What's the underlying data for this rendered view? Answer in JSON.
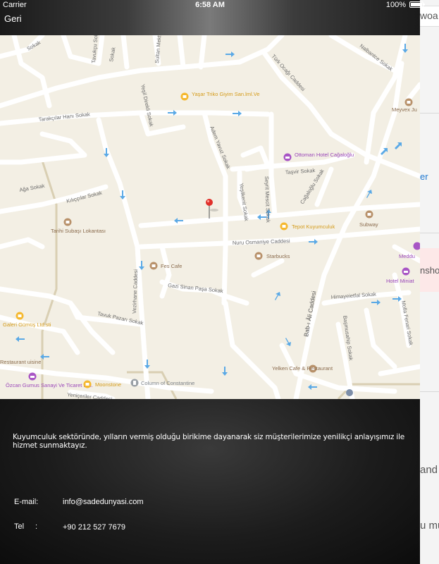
{
  "status_bar": {
    "carrier": "Carrier",
    "time": "6:58 AM",
    "battery": "100%"
  },
  "nav": {
    "back_label": "Geri"
  },
  "map": {
    "streets": [
      {
        "id": "s1",
        "label": "Sokak"
      },
      {
        "id": "s2",
        "label": "Tavukçu Sokak"
      },
      {
        "id": "s3",
        "label": "Sokak"
      },
      {
        "id": "s4",
        "label": "Sultan Mektebi Sokak"
      },
      {
        "id": "s5",
        "label": "Yeşil Direkli Sokak"
      },
      {
        "id": "s6",
        "label": "Türk Ocağı Caddesi"
      },
      {
        "id": "s7",
        "label": "Nalbantce Sokak"
      },
      {
        "id": "s8",
        "label": "Tarakçılar Hanı Sokak"
      },
      {
        "id": "s9",
        "label": "Adem Yavuz Sokak"
      },
      {
        "id": "s10",
        "label": "Taşvir Sokak"
      },
      {
        "id": "s11",
        "label": "Ağa Sokak"
      },
      {
        "id": "s12",
        "label": "Kılıççılar Sokak"
      },
      {
        "id": "s13",
        "label": "Yeşilkenit Sokak"
      },
      {
        "id": "s14",
        "label": "Seyrit Mescit Sokak"
      },
      {
        "id": "s15",
        "label": "Cağaloğlu Sokak"
      },
      {
        "id": "s16",
        "label": "Nuru Osmaniye Caddesi"
      },
      {
        "id": "s17",
        "label": "Vezirhane Caddesi"
      },
      {
        "id": "s18",
        "label": "Gazi Sinan Paşa Sokak"
      },
      {
        "id": "s19",
        "label": "Tavuk Pazarı Sokak"
      },
      {
        "id": "s20",
        "label": "Bab-ı Âli Caddesi"
      },
      {
        "id": "s21",
        "label": "Himayeietfal Sokak"
      },
      {
        "id": "s22",
        "label": "Başmusahip Sokak"
      },
      {
        "id": "s23",
        "label": "Molla Fenari Sokak"
      },
      {
        "id": "s24",
        "label": "Yeniçeriler Caddesi"
      }
    ],
    "pois": [
      {
        "id": "p1",
        "name": "Yaşar Triko Giyim San.lml.Ve",
        "icon": "shopping-bag-icon",
        "color": "#f5b82e"
      },
      {
        "id": "p2",
        "name": "Meyvex Ju",
        "icon": "cafe-icon",
        "color": "#b8916a"
      },
      {
        "id": "p3",
        "name": "Ottoman Hotel Cağaloğlu",
        "icon": "hotel-icon",
        "color": "#a855c5"
      },
      {
        "id": "p4",
        "name": "Subway",
        "icon": "food-icon",
        "color": "#b8916a"
      },
      {
        "id": "p5",
        "name": "Tepot Kuyumculuk",
        "icon": "shopping-bag-icon",
        "color": "#f5b82e"
      },
      {
        "id": "p6",
        "name": "Tarihi Subaşı Lokantası",
        "icon": "food-icon",
        "color": "#b8916a"
      },
      {
        "id": "p7",
        "name": "Starbucks",
        "icon": "cafe-icon",
        "color": "#b8916a"
      },
      {
        "id": "p8",
        "name": "Fes Cafe",
        "icon": "cafe-icon",
        "color": "#b8916a"
      },
      {
        "id": "p9",
        "name": "Meddu",
        "icon": "hotel-icon",
        "color": "#a855c5"
      },
      {
        "id": "p10",
        "name": "Hotel Miniat",
        "icon": "hotel-icon",
        "color": "#a855c5"
      },
      {
        "id": "p11",
        "name": "Galeri Gümüş Ltd.sti",
        "icon": "shopping-bag-icon",
        "color": "#f5b82e"
      },
      {
        "id": "p12",
        "name": "Restaurant uisine",
        "icon": "food-icon",
        "color": "#b8916a"
      },
      {
        "id": "p13",
        "name": "Özcan Gumus Sanayi Ve Ticaret L.S.",
        "icon": "hotel-icon",
        "color": "#a855c5"
      },
      {
        "id": "p14",
        "name": "Moonstone",
        "icon": "shopping-bag-icon",
        "color": "#f5b82e"
      },
      {
        "id": "p15",
        "name": "Column of Constantine",
        "icon": "landmark-icon",
        "color": "#9aa0a6"
      },
      {
        "id": "p16",
        "name": "Yelken Cafe & Restaurant",
        "icon": "cafe-icon",
        "color": "#b8916a"
      }
    ]
  },
  "info": {
    "description": "Kuyumculuk sektöründe, yılların vermiş olduğu birikime dayanarak siz müşterilerimize yenilikçi anlayışımız ile hizmet sunmaktayız.",
    "email_label": "E-mail:",
    "email": "info@sadedunyasi.com",
    "tel_label": "Tel",
    "colon": ":",
    "phone": "+90 212 527 7679"
  },
  "background_app": {
    "fragments": [
      "woa",
      "er",
      "nsho",
      "and",
      "u mu"
    ]
  },
  "colors": {
    "map_bg": "#f3efe4",
    "road": "#ffffff",
    "oneway_arrow": "#5aa9e6",
    "pin": "#e0302a"
  }
}
